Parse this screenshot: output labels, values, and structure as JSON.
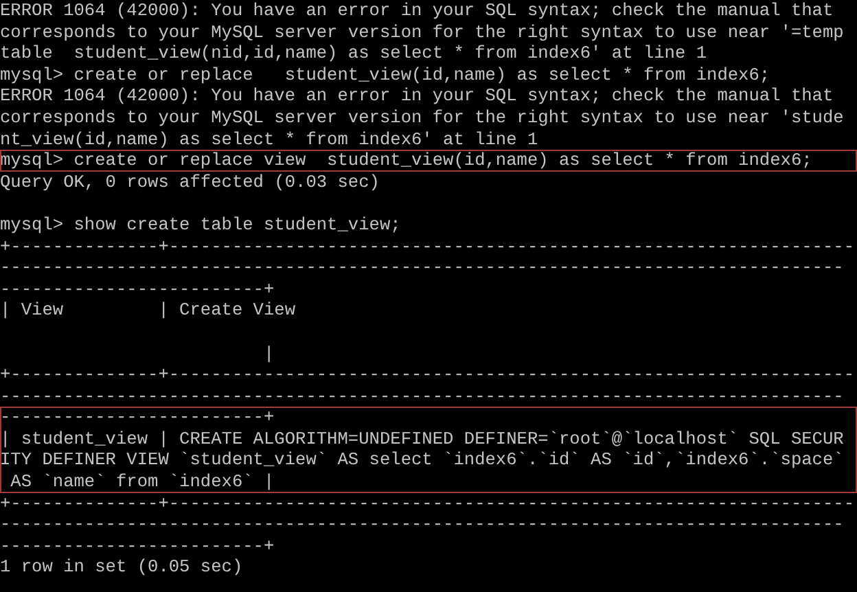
{
  "blocks": [
    {
      "highlighted": false,
      "lines": [
        {
          "kind": "text",
          "text": "ERROR 1064 (42000): You have an error in your SQL syntax; check the manual that"
        },
        {
          "kind": "text",
          "text": "corresponds to your MySQL server version for the right syntax to use near '=temp"
        },
        {
          "kind": "text",
          "text": "table  student_view(nid,id,name) as select * from index6' at line 1"
        },
        {
          "kind": "text",
          "text": "mysql> create or replace   student_view(id,name) as select * from index6;"
        },
        {
          "kind": "text",
          "text": "ERROR 1064 (42000): You have an error in your SQL syntax; check the manual that"
        },
        {
          "kind": "text",
          "text": "corresponds to your MySQL server version for the right syntax to use near 'stude"
        },
        {
          "kind": "text",
          "text": "nt_view(id,name) as select * from index6' at line 1"
        }
      ]
    },
    {
      "highlighted": true,
      "lines": [
        {
          "kind": "text",
          "text": "mysql> create or replace view  student_view(id,name) as select * from index6;"
        }
      ]
    },
    {
      "highlighted": false,
      "lines": [
        {
          "kind": "text",
          "text": "Query OK, 0 rows affected (0.03 sec)"
        },
        {
          "kind": "blank"
        },
        {
          "kind": "text",
          "text": "mysql> show create table student_view;"
        },
        {
          "kind": "text",
          "text": "+--------------+-----------------------------------------------------------------"
        },
        {
          "kind": "text",
          "text": "--------------------------------------------------------------------------------"
        },
        {
          "kind": "text",
          "text": "-------------------------+"
        },
        {
          "kind": "text",
          "text": "| View         | Create View"
        },
        {
          "kind": "blank"
        },
        {
          "kind": "text",
          "text": "                         |"
        },
        {
          "kind": "text",
          "text": "+--------------+-----------------------------------------------------------------"
        },
        {
          "kind": "text",
          "text": "--------------------------------------------------------------------------------"
        }
      ]
    },
    {
      "highlighted": true,
      "lines": [
        {
          "kind": "text",
          "text": "-------------------------+"
        },
        {
          "kind": "text",
          "text": "| student_view | CREATE ALGORITHM=UNDEFINED DEFINER=`root`@`localhost` SQL SECUR"
        },
        {
          "kind": "text",
          "text": "ITY DEFINER VIEW `student_view` AS select `index6`.`id` AS `id`,`index6`.`space`"
        },
        {
          "kind": "text",
          "text": " AS `name` from `index6` |"
        }
      ]
    },
    {
      "highlighted": false,
      "lines": [
        {
          "kind": "text",
          "text": "+--------------+-----------------------------------------------------------------"
        },
        {
          "kind": "text",
          "text": "--------------------------------------------------------------------------------"
        },
        {
          "kind": "text",
          "text": "-------------------------+"
        },
        {
          "kind": "text",
          "text": "1 row in set (0.05 sec)"
        }
      ]
    }
  ]
}
